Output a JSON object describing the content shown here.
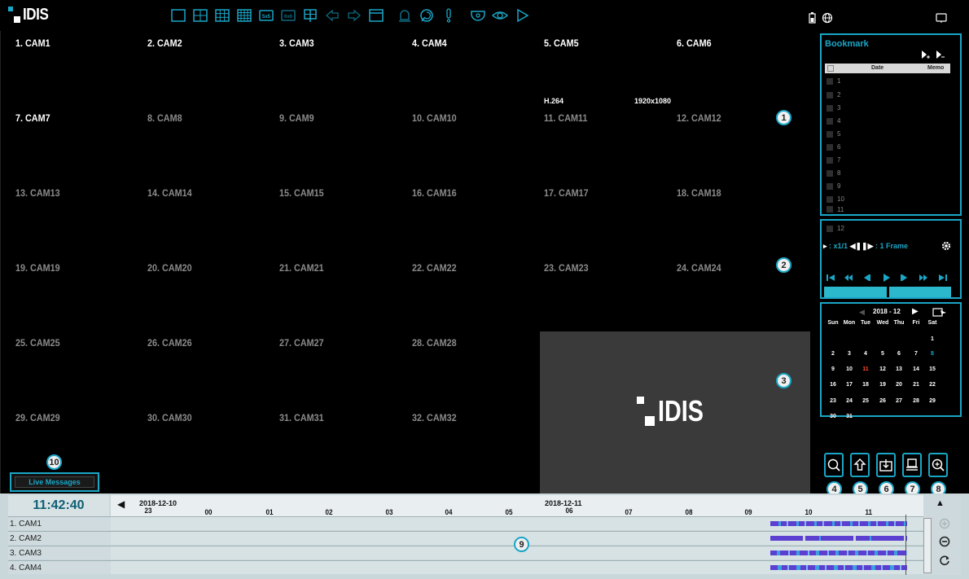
{
  "app": {
    "logo_text": "IDIS"
  },
  "toolbar": {
    "icons": [
      "layout-1x1-icon",
      "layout-2x2-icon",
      "layout-3x3-icon",
      "layout-4x4-icon",
      "layout-5x5-icon",
      "layout-6x6-icon",
      "sequence-layout-icon",
      "previous-group-icon",
      "next-group-icon",
      "full-screen-icon",
      "alarm-icon",
      "playback-icon",
      "event-icon",
      "dome-camera-icon",
      "eye-view-icon",
      "play-icon"
    ],
    "label_5x5": "5x5",
    "label_6x6": "6x6"
  },
  "cameras": [
    "1. CAM1",
    "2. CAM2",
    "3. CAM3",
    "4. CAM4",
    "5. CAM5",
    "6. CAM6",
    "7. CAM7",
    "8. CAM8",
    "9. CAM9",
    "10. CAM10",
    "11. CAM11",
    "12. CAM12",
    "13. CAM13",
    "14. CAM14",
    "15. CAM15",
    "16. CAM16",
    "17. CAM17",
    "18. CAM18",
    "19. CAM19",
    "20. CAM20",
    "21. CAM21",
    "22. CAM22",
    "23. CAM23",
    "24. CAM24",
    "25. CAM25",
    "26. CAM26",
    "27. CAM27",
    "28. CAM28",
    "29. CAM29",
    "30. CAM30",
    "31. CAM31",
    "32. CAM32"
  ],
  "stream_info": {
    "codec": "H.264",
    "resolution": "1920x1080"
  },
  "brand_panel_text": "IDIS",
  "badges": [
    "1",
    "2",
    "3",
    "4",
    "5",
    "6",
    "7",
    "8",
    "9",
    "10"
  ],
  "live_messages": {
    "label": "Live Messages"
  },
  "bookmark": {
    "title": "Bookmark",
    "columns": [
      "Date",
      "Memo"
    ],
    "rows": [
      "1",
      "2",
      "3",
      "4",
      "5",
      "6",
      "7",
      "8",
      "9",
      "10",
      "11",
      "12"
    ]
  },
  "playback": {
    "speed_text": ": x1/1",
    "frame_text": ": 1 Frame"
  },
  "calendar": {
    "month_label": "2018 - 12",
    "days_of_week": [
      "Sun",
      "Mon",
      "Tue",
      "Wed",
      "Thu",
      "Fri",
      "Sat"
    ],
    "weeks": [
      [
        "",
        "",
        "",
        "",
        "",
        "",
        "1"
      ],
      [
        "2",
        "3",
        "4",
        "5",
        "6",
        "7",
        "8"
      ],
      [
        "9",
        "10",
        "11",
        "12",
        "13",
        "14",
        "15"
      ],
      [
        "16",
        "17",
        "18",
        "19",
        "20",
        "21",
        "22"
      ],
      [
        "23",
        "24",
        "25",
        "26",
        "27",
        "28",
        "29"
      ],
      [
        "30",
        "31",
        "",
        "",
        "",
        "",
        ""
      ]
    ],
    "selected_day": "11",
    "highlight_day": "8",
    "colors": {
      "selected": "#ff4a2a",
      "highlight": "#1aa6c7"
    }
  },
  "timeline": {
    "clock": "11:42:40",
    "date_left": "2018-12-10",
    "date_right": "2018-12-11",
    "hours": [
      "23",
      "00",
      "01",
      "02",
      "03",
      "04",
      "05",
      "06",
      "07",
      "08",
      "09",
      "10",
      "11"
    ],
    "rows": [
      "1. CAM1",
      "2. CAM2",
      "3. CAM3",
      "4. CAM4"
    ]
  },
  "colors": {
    "accent": "#1aa6c7",
    "record_purple": "#5b3fd1",
    "record_blue": "#3ba0e0"
  }
}
